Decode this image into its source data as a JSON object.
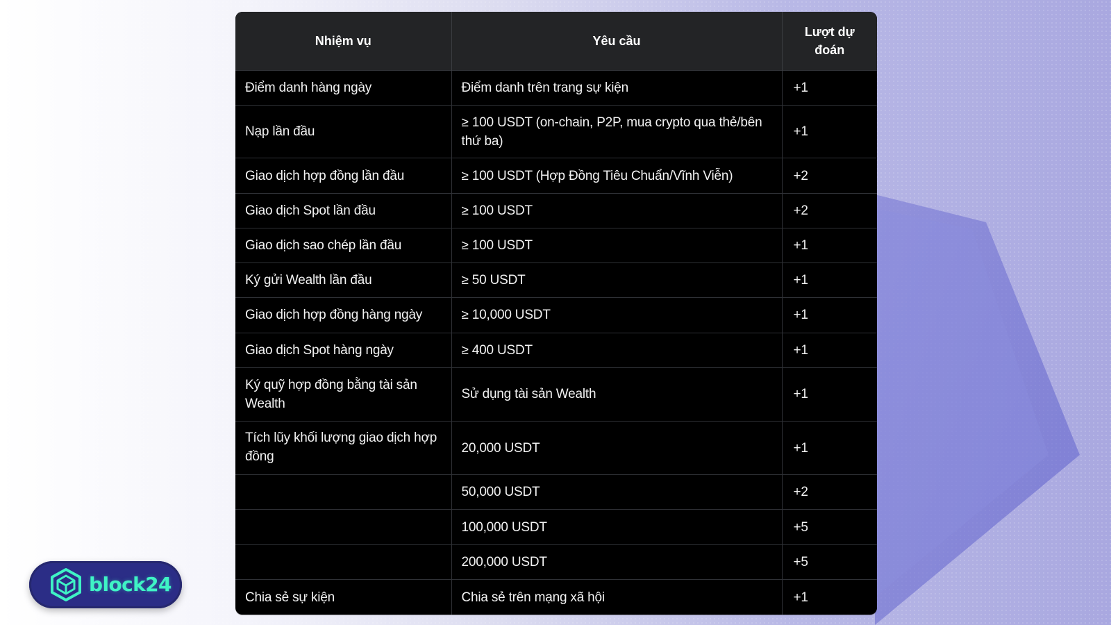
{
  "table": {
    "headers": [
      "Nhiệm vụ",
      "Yêu cầu",
      "Lượt dự đoán"
    ],
    "rows": [
      {
        "task": "Điểm danh hàng ngày",
        "requirement": "Điểm danh trên trang sự kiện",
        "reward": "+1"
      },
      {
        "task": "Nạp lần đầu",
        "requirement": "≥ 100 USDT (on-chain, P2P, mua crypto qua thẻ/bên thứ ba)",
        "reward": "+1"
      },
      {
        "task": "Giao dịch hợp đồng lần đầu",
        "requirement": "≥ 100 USDT (Hợp Đồng Tiêu Chuẩn/Vĩnh Viễn)",
        "reward": "+2"
      },
      {
        "task": "Giao dịch Spot lần đầu",
        "requirement": "≥ 100 USDT",
        "reward": "+2"
      },
      {
        "task": "Giao dịch sao chép lần đầu",
        "requirement": "≥ 100 USDT",
        "reward": "+1"
      },
      {
        "task": "Ký gửi Wealth lần đầu",
        "requirement": "≥ 50 USDT",
        "reward": "+1"
      },
      {
        "task": "Giao dịch hợp đồng hàng ngày",
        "requirement": "≥ 10,000 USDT",
        "reward": "+1"
      },
      {
        "task": "Giao dịch Spot hàng ngày",
        "requirement": "≥ 400 USDT",
        "reward": "+1"
      },
      {
        "task": "Ký quỹ hợp đồng bằng tài sản Wealth",
        "requirement": "Sử dụng tài sản Wealth",
        "reward": "+1"
      },
      {
        "task": "Tích lũy khối lượng giao dịch hợp đồng",
        "requirement": "20,000 USDT",
        "reward": "+1"
      },
      {
        "task": "",
        "requirement": "50,000 USDT",
        "reward": "+2"
      },
      {
        "task": "",
        "requirement": "100,000 USDT",
        "reward": "+5"
      },
      {
        "task": "",
        "requirement": "200,000 USDT",
        "reward": "+5"
      },
      {
        "task": "Chia sẻ sự kiện",
        "requirement": "Chia sẻ trên mạng xã hội",
        "reward": "+1"
      }
    ]
  },
  "logo": {
    "text": "block24",
    "icon": "cube-icon",
    "color": "#3ff3c5",
    "background": "#2b2d86"
  }
}
